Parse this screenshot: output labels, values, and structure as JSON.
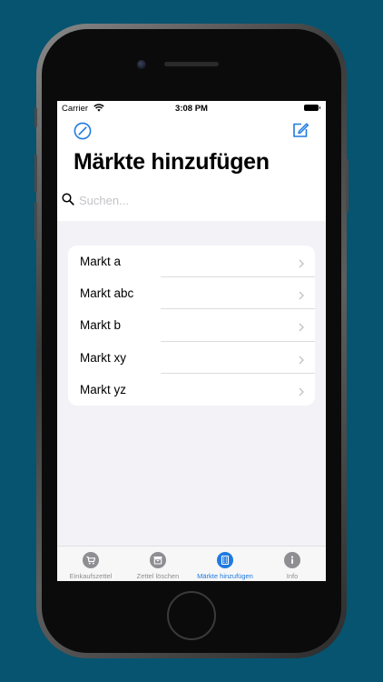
{
  "status": {
    "carrier": "Carrier",
    "time": "3:08 PM"
  },
  "nav": {
    "left_icon": "compass-icon",
    "right_icon": "compose-icon"
  },
  "title": "Märkte hinzufügen",
  "search": {
    "placeholder": "Suchen...",
    "value": ""
  },
  "list": [
    {
      "label": "Markt a"
    },
    {
      "label": "Markt abc"
    },
    {
      "label": "Markt b"
    },
    {
      "label": "Markt xy"
    },
    {
      "label": "Markt yz"
    }
  ],
  "tabs": [
    {
      "label": "Einkaufszettel",
      "icon": "cart-icon",
      "active": false
    },
    {
      "label": "Zettel löschen",
      "icon": "archive-icon",
      "active": false
    },
    {
      "label": "Märkte hinzufügen",
      "icon": "building-icon",
      "active": true
    },
    {
      "label": "Info",
      "icon": "info-icon",
      "active": false
    }
  ],
  "colors": {
    "accent": "#1f7ae0",
    "background": "#065470",
    "inactive": "#8e8e93"
  }
}
